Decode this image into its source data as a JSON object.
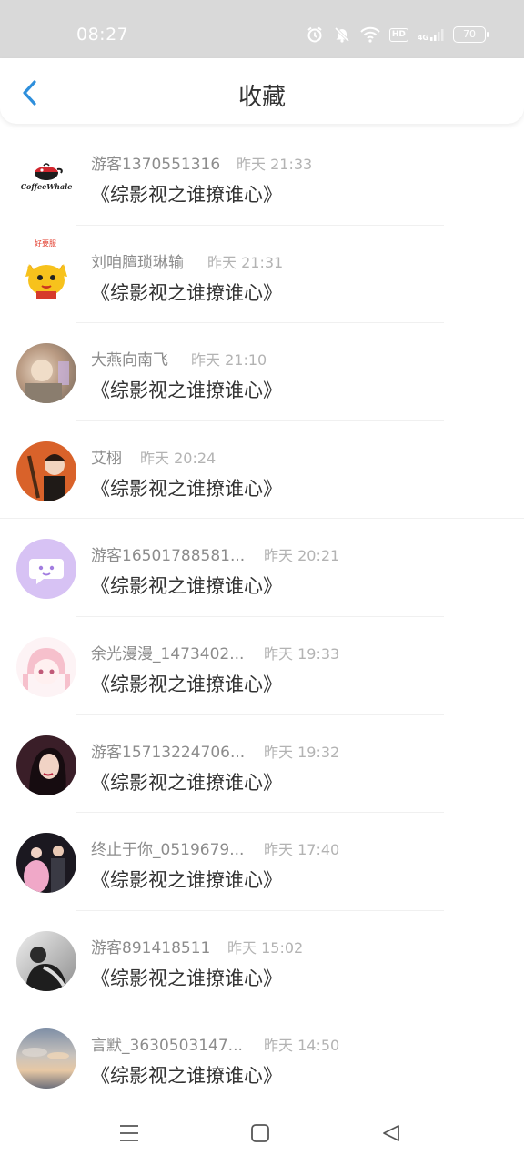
{
  "status_bar": {
    "time": "08:27",
    "net_type": "HD",
    "signal_label": "4G",
    "battery": "70"
  },
  "header": {
    "title": "收藏",
    "back_icon": "chevron-left-icon",
    "accent": "#2e8fdc"
  },
  "favorites": [
    {
      "username": "游客1370551316",
      "time": "昨天 21:33",
      "title": "《综影视之谁撩谁心》",
      "avatar_logo": "CoffeeWhale"
    },
    {
      "username": "刘咱膻琐琳输",
      "time": "昨天 21:31",
      "title": "《综影视之谁撩谁心》",
      "avatar_badge": "好要服"
    },
    {
      "username": "大燕向南飞",
      "time": "昨天 21:10",
      "title": "《综影视之谁撩谁心》"
    },
    {
      "username": "艾栩",
      "time": "昨天 20:24",
      "title": "《综影视之谁撩谁心》"
    },
    {
      "username": "游客16501788581...",
      "time": "昨天 20:21",
      "title": "《综影视之谁撩谁心》"
    },
    {
      "username": "余光漫漫_1473402...",
      "time": "昨天 19:33",
      "title": "《综影视之谁撩谁心》"
    },
    {
      "username": "游客15713224706...",
      "time": "昨天 19:32",
      "title": "《综影视之谁撩谁心》"
    },
    {
      "username": "终止于你_0519679...",
      "time": "昨天 17:40",
      "title": "《综影视之谁撩谁心》"
    },
    {
      "username": "游客891418511",
      "time": "昨天 15:02",
      "title": "《综影视之谁撩谁心》"
    },
    {
      "username": "言默_3630503147...",
      "time": "昨天 14:50",
      "title": "《综影视之谁撩谁心》"
    }
  ],
  "nav": {
    "menu_icon": "menu-icon",
    "home_icon": "home-square-icon",
    "back_icon": "back-triangle-icon"
  }
}
